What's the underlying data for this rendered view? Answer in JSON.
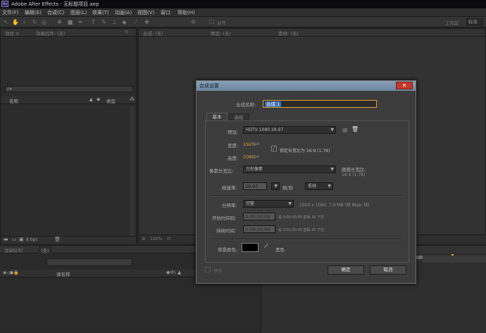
{
  "window": {
    "title": "Adobe After Effects - 无标题项目.aep",
    "logo": "Ae"
  },
  "menu": [
    "文件(F)",
    "编辑(E)",
    "合成(C)",
    "图层(L)",
    "效果(T)",
    "动画(A)",
    "视图(V)",
    "窗口",
    "帮助(H)"
  ],
  "toolbar": {
    "workspace_label": "工作区",
    "workspace_value": "标准",
    "extra": "对齐"
  },
  "project_panel": {
    "tab_label": "项目 ≡",
    "effects_tab": "效果控件: (无)",
    "search_placeholder": "ρ▾",
    "col_name": "名称",
    "col_type": "类型",
    "bpc": "8 bpc"
  },
  "comp_panel": {
    "tab1": "合成: (无)",
    "tab2": "图层: (无)",
    "tab3": "素材: (无)",
    "zoom": "100%"
  },
  "timeline": {
    "tab1": "渲染队列",
    "tab2": "(无)",
    "col_source": "源名称"
  },
  "dialog": {
    "title": "合成设置",
    "name_label": "合成名称:",
    "name_value": "合成 1",
    "tabs": [
      "基本",
      "高级"
    ],
    "preset_label": "预设:",
    "preset_value": "HDTV 1080 29.97",
    "width_label": "宽度:",
    "width_value": "1920",
    "height_label": "高度:",
    "height_value": "1080",
    "px": "px",
    "lock_label": "锁定长宽比为 16:9 (1.78)",
    "par_label": "像素长宽比:",
    "par_value": "方形像素",
    "frame_aspect_label": "画面长宽比:",
    "frame_aspect_value": "16:9 (1.78)",
    "fps_label": "帧速率:",
    "fps_value": "29.97",
    "fps_unit": "帧/秒",
    "drop_frame": "丢帧",
    "res_label": "分辨率:",
    "res_value": "完整",
    "res_info": "1920 x 1080, 7.9 MB (每 8bpc 帧)",
    "start_label": "开始时间码:",
    "start_value": "0;00;00;00",
    "start_info": "是 0;00;00;00  基础 30 下拉",
    "dur_label": "持续时间:",
    "dur_value": "0;00;30;00",
    "dur_info": "是 0;00;30;00  基础 30 下拉",
    "bg_label": "背景颜色:",
    "bg_name": "黑色",
    "bg_color": "#000000",
    "preview": "预览",
    "ok": "确定",
    "cancel": "取消"
  },
  "colors": {
    "accent": "#d9a238",
    "title_bar": "#7a90a8",
    "close": "#c0392b"
  }
}
